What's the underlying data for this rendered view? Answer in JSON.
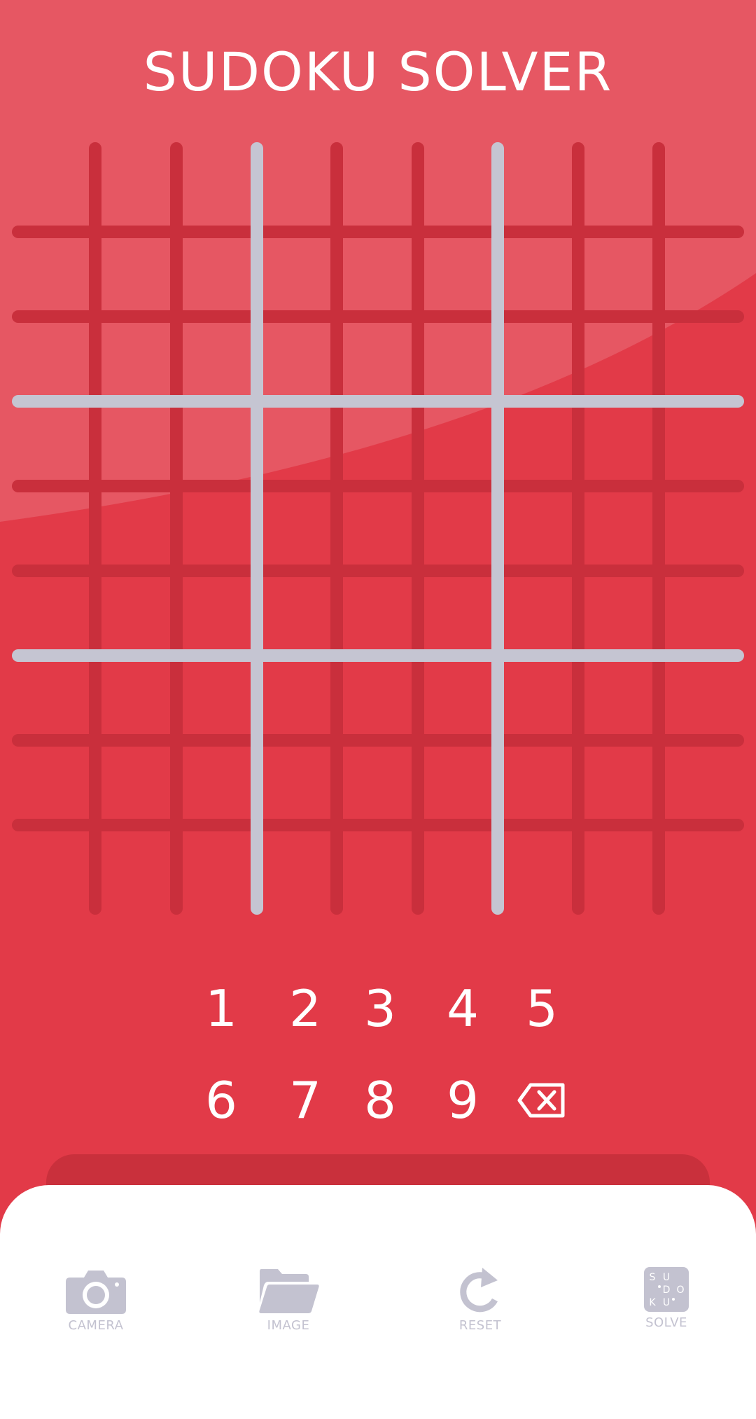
{
  "app": {
    "title": "SUDOKU SOLVER"
  },
  "colors": {
    "background": "#e23a48",
    "thin_line": "#c92f3c",
    "thick_line": "#c5c5d2",
    "icon": "#c3c2d0",
    "panel": "#ffffff"
  },
  "board": {
    "rows": [
      [
        "",
        "",
        "",
        "",
        "",
        "",
        "",
        "",
        ""
      ],
      [
        "",
        "",
        "",
        "",
        "",
        "",
        "",
        "",
        ""
      ],
      [
        "",
        "",
        "",
        "",
        "",
        "",
        "",
        "",
        ""
      ],
      [
        "",
        "",
        "",
        "",
        "",
        "",
        "",
        "",
        ""
      ],
      [
        "",
        "",
        "",
        "",
        "",
        "",
        "",
        "",
        ""
      ],
      [
        "",
        "",
        "",
        "",
        "",
        "",
        "",
        "",
        ""
      ],
      [
        "",
        "",
        "",
        "",
        "",
        "",
        "",
        "",
        ""
      ],
      [
        "",
        "",
        "",
        "",
        "",
        "",
        "",
        "",
        ""
      ],
      [
        "",
        "",
        "",
        "",
        "",
        "",
        "",
        "",
        ""
      ]
    ]
  },
  "numpad": {
    "keys": [
      "1",
      "2",
      "3",
      "4",
      "5",
      "6",
      "7",
      "8",
      "9"
    ],
    "backspace_icon": "backspace-icon"
  },
  "toolbar": {
    "camera": {
      "label": "CAMERA",
      "icon": "camera-icon"
    },
    "image": {
      "label": "IMAGE",
      "icon": "folder-icon"
    },
    "reset": {
      "label": "RESET",
      "icon": "reset-icon"
    },
    "solve": {
      "label": "SOLVE",
      "icon": "sudoku-solve-icon",
      "letters": [
        "S",
        "U",
        "D",
        "O",
        "K",
        "U"
      ]
    }
  }
}
